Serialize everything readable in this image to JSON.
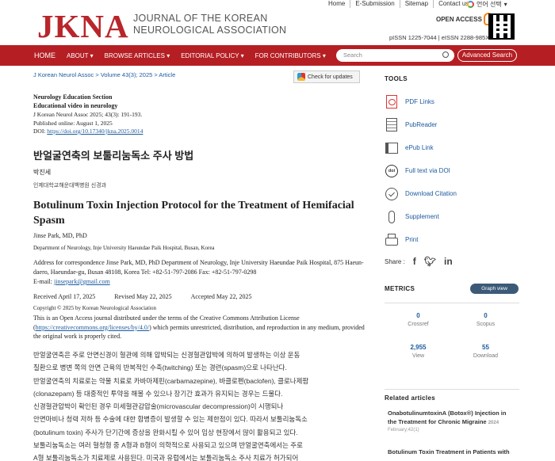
{
  "header": {
    "logo": "JKNA",
    "logo_sub_1": "JOURNAL OF THE KOREAN",
    "logo_sub_2": "NEUROLOGICAL ASSOCIATION",
    "top_links": [
      "Home",
      "E-Submission",
      "Sitemap",
      "Contact us"
    ],
    "language": "언어 선택",
    "open_access": "OPEN ACCESS",
    "issn": "pISSN 1225-7044  |  eISSN 2288-985X"
  },
  "nav": {
    "items": [
      "HOME",
      "ABOUT ▾",
      "BROWSE ARTICLES ▾",
      "EDITORIAL POLICY ▾",
      "FOR CONTRIBUTORS ▾"
    ],
    "search_placeholder": "Search",
    "advanced_search": "Advanced Search"
  },
  "article": {
    "breadcrumb": "J Korean Neurol Assoc > Volume 43(3); 2025 > Article",
    "check_updates": "Check for updates",
    "section_1": "Neurology Education Section",
    "section_2": "Educational video in neurology",
    "citation": "J Korean Neurol Assoc 2025; 43(3): 191-193.",
    "published": "Published online: August 1, 2025",
    "doi_label": "DOI: ",
    "doi": "https://doi.org/10.17340/jkna.2025.0014",
    "ko_title": "반얼굴연축의 보툴리눔독소 주사 방법",
    "ko_author": "박진세",
    "ko_affiliation": "인제대학교해운대백병원 신경과",
    "en_title": "Botulinum Toxin Injection Protocol for the Treatment of Hemifacial Spasm",
    "en_author": "Jinse Park, MD, PhD",
    "en_affiliation": "Department of Neurology, Inje University Haeundae Paik Hospital, Busan, Korea",
    "correspondence": "Address for correspondence Jinse Park, MD, PhD Department of Neurology, Inje University Haeundae Paik Hospital, 875 Haeun-daero, Haeundae-gu, Busan 48108, Korea Tel: +82-51-797-2086 Fax: +82-51-797-0298",
    "email_label": "E-mail: ",
    "email": "jinsepark@gmail.com",
    "received": "Received April 17, 2025",
    "revised": "Revised May 22, 2025",
    "accepted": "Accepted May 22, 2025",
    "copyright": "Copyright © 2025 by Korean Neurological Association",
    "license_1": "This is an Open Access journal distributed under the terms of the Creative Commons Attribution License (",
    "license_link": "https://creativecommons.org/licenses/by/4.0/",
    "license_2": ") which permits unrestricted, distribution, and reproduction in any medium, provided the original work is properly cited.",
    "body": [
      "반얼굴연축은 주로 안면신경이 혈관에 의해 압박되는 신경혈관압박에 의하여 발생하는 이상 운동",
      "질환으로 병변 쪽의 안면 근육의 반복적인 수축(twitching) 또는 경련(spasm)으로 나타난다.",
      "반얼굴연축의 치료로는 약물 치료로 카바마제핀(carbamazepine), 바클로펜(baclofen), 클로나제팜",
      "(clonazepam) 등 대중적인 투약을 해볼 수 있으나 장기간 효과가 유지되는 경우는 드물다.",
      "신경혈관압박이 확인된 경우 미세혈관감압술(microvascular decompression)이 시행되나",
      "안면마비나 청력 저하 등 수술에 대한 합병증이 발생할 수 있는 제한점이 있다. 따라서 보툴리눔독소",
      "(botulinum toxin) 주사가 단기간에 증상을 완화시킬 수 있어 임상 현장에서 많이 활용되고 있다.",
      "보툴리눔독소는 여러 혈청형 중 A형과 B형이 의학적으로 사용되고 있으며 반얼굴연축에서는 주로",
      "A형 보툴리눔독소가 치료제로 사용된다. 미국과 유럽에서는 보툴리눔독소 주사 치료가 허가되어"
    ]
  },
  "sidebar": {
    "tools_heading": "TOOLS",
    "tools": [
      "PDF Links",
      "PubReader",
      "ePub Link",
      "Full text via DOI",
      "Download Citation",
      "Supplement",
      "Print"
    ],
    "share_label": "Share :",
    "metrics_heading": "METRICS",
    "graph_view": "Graph view",
    "metrics": [
      {
        "value": "0",
        "label": "Crossref"
      },
      {
        "value": "0",
        "label": "Scopus"
      },
      {
        "value": "2,955",
        "label": "View"
      },
      {
        "value": "55",
        "label": "Download"
      }
    ],
    "related_heading": "Related articles",
    "related": [
      {
        "title": "OnabotulinumtoxinA (Botox®) Injection in the Treatment for Chronic Migraine",
        "year": "2024",
        "issue": "February;42(1)"
      },
      {
        "title": "Botulinum Toxin Treatment in Patients with",
        "year": "",
        "issue": ""
      }
    ]
  }
}
